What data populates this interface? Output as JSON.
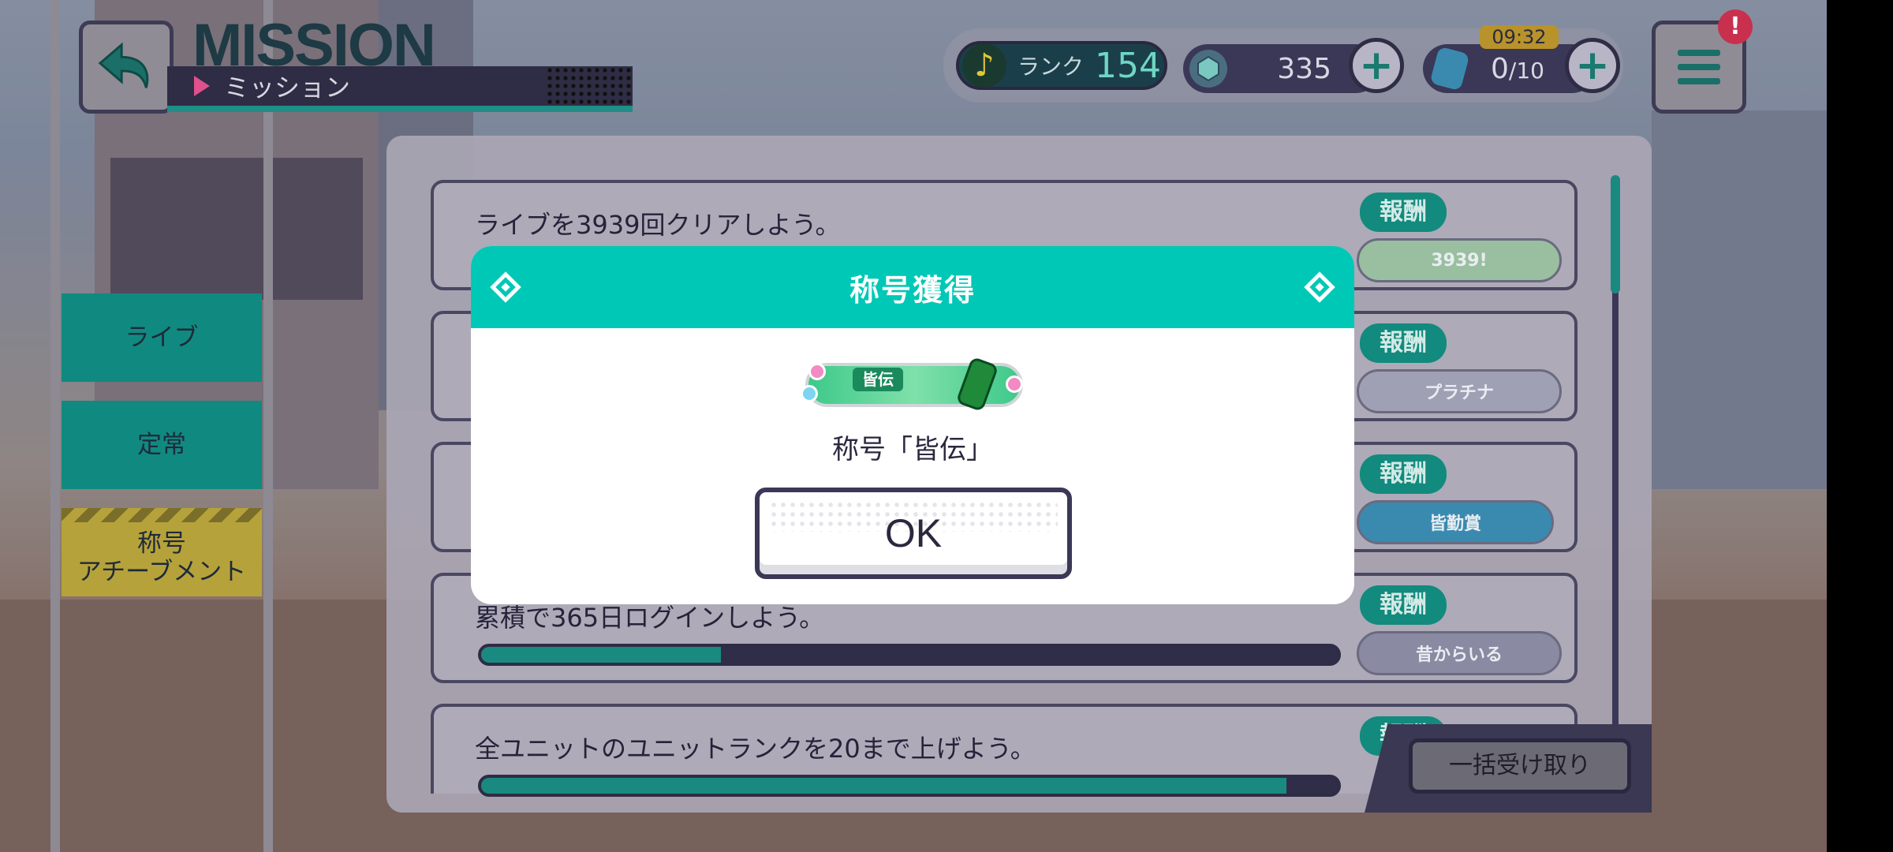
{
  "header": {
    "title_en": "MISSION",
    "title_jp": "ミッション",
    "back_icon": "back-arrow-icon"
  },
  "status": {
    "rank_label": "ランク",
    "rank_value": "154",
    "gems": "335",
    "energy": "0",
    "energy_max": "/10",
    "timer": "09:32",
    "plus_symbol": "+",
    "alert": "!"
  },
  "sidebar": {
    "items": [
      {
        "label": "ライブ"
      },
      {
        "label": "定常"
      },
      {
        "label": "称号\nアチーブメント"
      }
    ]
  },
  "missions": [
    {
      "text": "ライブを3939回クリアしよう。",
      "reward_tag": "報酬",
      "reward_badge": "3939!"
    },
    {
      "text": "",
      "reward_tag": "報酬",
      "reward_badge": "プラチナ"
    },
    {
      "text": "",
      "reward_tag": "報酬",
      "reward_badge": "皆勤賞"
    },
    {
      "text": "累積で365日ログインしよう。",
      "reward_tag": "報酬",
      "reward_badge": "昔からいる",
      "progress": 0.28
    },
    {
      "text": "全ユニットのユニットランクを20まで上げよう。",
      "reward_tag": "報酬",
      "reward_badge": "",
      "progress": 0.94
    }
  ],
  "bulk_button": "一括受け取り",
  "modal": {
    "title": "称号獲得",
    "plate_label": "皆伝",
    "text": "称号「皆伝」",
    "ok": "OK"
  },
  "colors": {
    "accent": "#00c8b6",
    "alert": "#c8304e"
  }
}
